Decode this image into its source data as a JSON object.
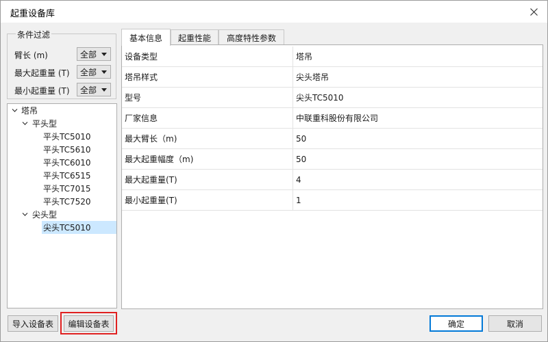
{
  "window": {
    "title": "起重设备库"
  },
  "filter": {
    "legend": "条件过滤",
    "rows": [
      {
        "label": "臂长 (m)",
        "value": "全部"
      },
      {
        "label": "最大起重量 (T)",
        "value": "全部"
      },
      {
        "label": "最小起重量 (T)",
        "value": "全部"
      }
    ]
  },
  "tree": {
    "root": "塔吊",
    "groups": [
      {
        "label": "平头型",
        "items": [
          "平头TC5010",
          "平头TC5610",
          "平头TC6010",
          "平头TC6515",
          "平头TC7015",
          "平头TC7520"
        ]
      },
      {
        "label": "尖头型",
        "items": [
          "尖头TC5010"
        ]
      }
    ],
    "selected": "尖头TC5010"
  },
  "tabs": [
    "基本信息",
    "起重性能",
    "高度特性参数"
  ],
  "properties": [
    {
      "key": "设备类型",
      "value": "塔吊"
    },
    {
      "key": "塔吊样式",
      "value": "尖头塔吊"
    },
    {
      "key": "型号",
      "value": "尖头TC5010"
    },
    {
      "key": "厂家信息",
      "value": "中联重科股份有限公司"
    },
    {
      "key": "最大臂长（m)",
      "value": "50"
    },
    {
      "key": "最大起重幅度（m)",
      "value": "50"
    },
    {
      "key": "最大起重量(T)",
      "value": "4"
    },
    {
      "key": "最小起重量(T)",
      "value": "1"
    }
  ],
  "buttons": {
    "import": "导入设备表",
    "edit": "编辑设备表",
    "ok": "确定",
    "cancel": "取消"
  },
  "colors": {
    "selected_bg": "#cce8ff",
    "highlight": "#e02020",
    "primary_border": "#0078d7"
  }
}
